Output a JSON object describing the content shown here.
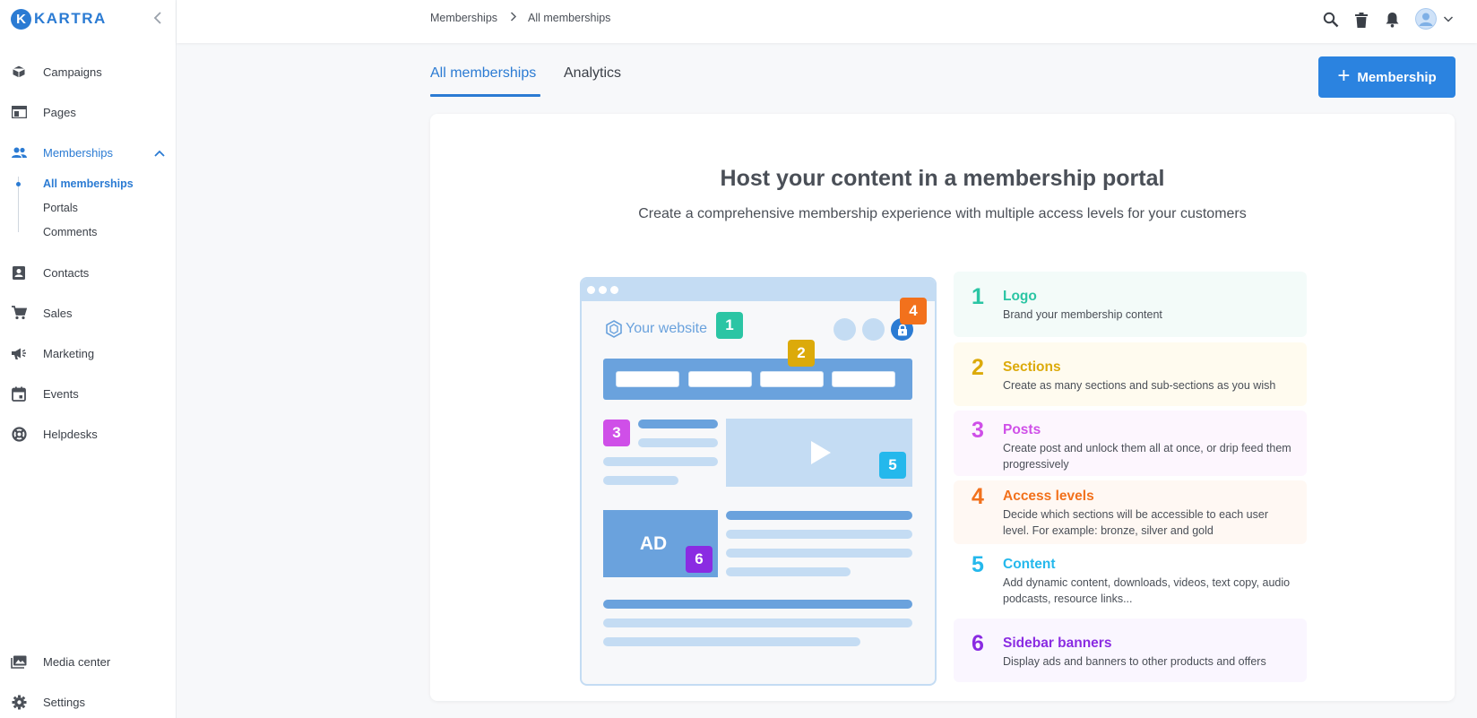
{
  "brand": {
    "name": "KARTRA",
    "mark": "K",
    "color": "#2b7bd3"
  },
  "sidebar": {
    "items": [
      {
        "label": "Campaigns",
        "icon": "cube-icon"
      },
      {
        "label": "Pages",
        "icon": "browser-window-icon"
      },
      {
        "label": "Memberships",
        "icon": "people-icon",
        "active": true,
        "expanded": true
      },
      {
        "label": "Contacts",
        "icon": "contact-card-icon"
      },
      {
        "label": "Sales",
        "icon": "cart-icon"
      },
      {
        "label": "Marketing",
        "icon": "megaphone-icon"
      },
      {
        "label": "Events",
        "icon": "calendar-icon"
      },
      {
        "label": "Helpdesks",
        "icon": "lifebuoy-icon"
      }
    ],
    "memberships_sub": [
      {
        "label": "All memberships",
        "active": true
      },
      {
        "label": "Portals"
      },
      {
        "label": "Comments"
      }
    ],
    "bottom": [
      {
        "label": "Media center",
        "icon": "media-folder-icon"
      },
      {
        "label": "Settings",
        "icon": "gear-icon"
      }
    ]
  },
  "topbar": {
    "breadcrumb": [
      "Memberships",
      "All memberships"
    ],
    "icons": [
      "search-icon",
      "trash-icon",
      "bell-icon",
      "avatar",
      "chevron-down-icon"
    ]
  },
  "tabs": [
    {
      "label": "All memberships",
      "active": true
    },
    {
      "label": "Analytics"
    }
  ],
  "add_button": {
    "label": "Membership",
    "icon": "plus-icon",
    "color": "#2b83e0"
  },
  "hero": {
    "title": "Host your content in a membership portal",
    "subtitle": "Create a comprehensive membership experience with multiple access levels for your customers"
  },
  "illustration": {
    "site_label": "Your website",
    "ad_label": "AD",
    "badges": [
      "1",
      "2",
      "3",
      "4",
      "5",
      "6"
    ]
  },
  "features": [
    {
      "num": "1",
      "title": "Logo",
      "desc": "Brand your membership content",
      "color": "#2bc5a4",
      "bg": "#f3fbf9"
    },
    {
      "num": "2",
      "title": "Sections",
      "desc": "Create as many sections and sub-sections as you wish",
      "color": "#dcaa0a",
      "bg": "#fffbef"
    },
    {
      "num": "3",
      "title": "Posts",
      "desc": "Create post and unlock them all at once, or drip feed them progressively",
      "color": "#cf4fe8",
      "bg": "#fdf6fe"
    },
    {
      "num": "4",
      "title": "Access levels",
      "desc": "Decide which sections will be accessible to each user level. For example: bronze, silver and gold",
      "color": "#f2711c",
      "bg": "#fff8f3"
    },
    {
      "num": "5",
      "title": "Content",
      "desc": "Add dynamic content, downloads, videos, text copy, audio podcasts, resource links...",
      "color": "#24b8ec",
      "bg": "#ffffff"
    },
    {
      "num": "6",
      "title": "Sidebar banners",
      "desc": "Display ads and banners to other products and offers",
      "color": "#8a2be2",
      "bg": "#faf6ff"
    }
  ]
}
